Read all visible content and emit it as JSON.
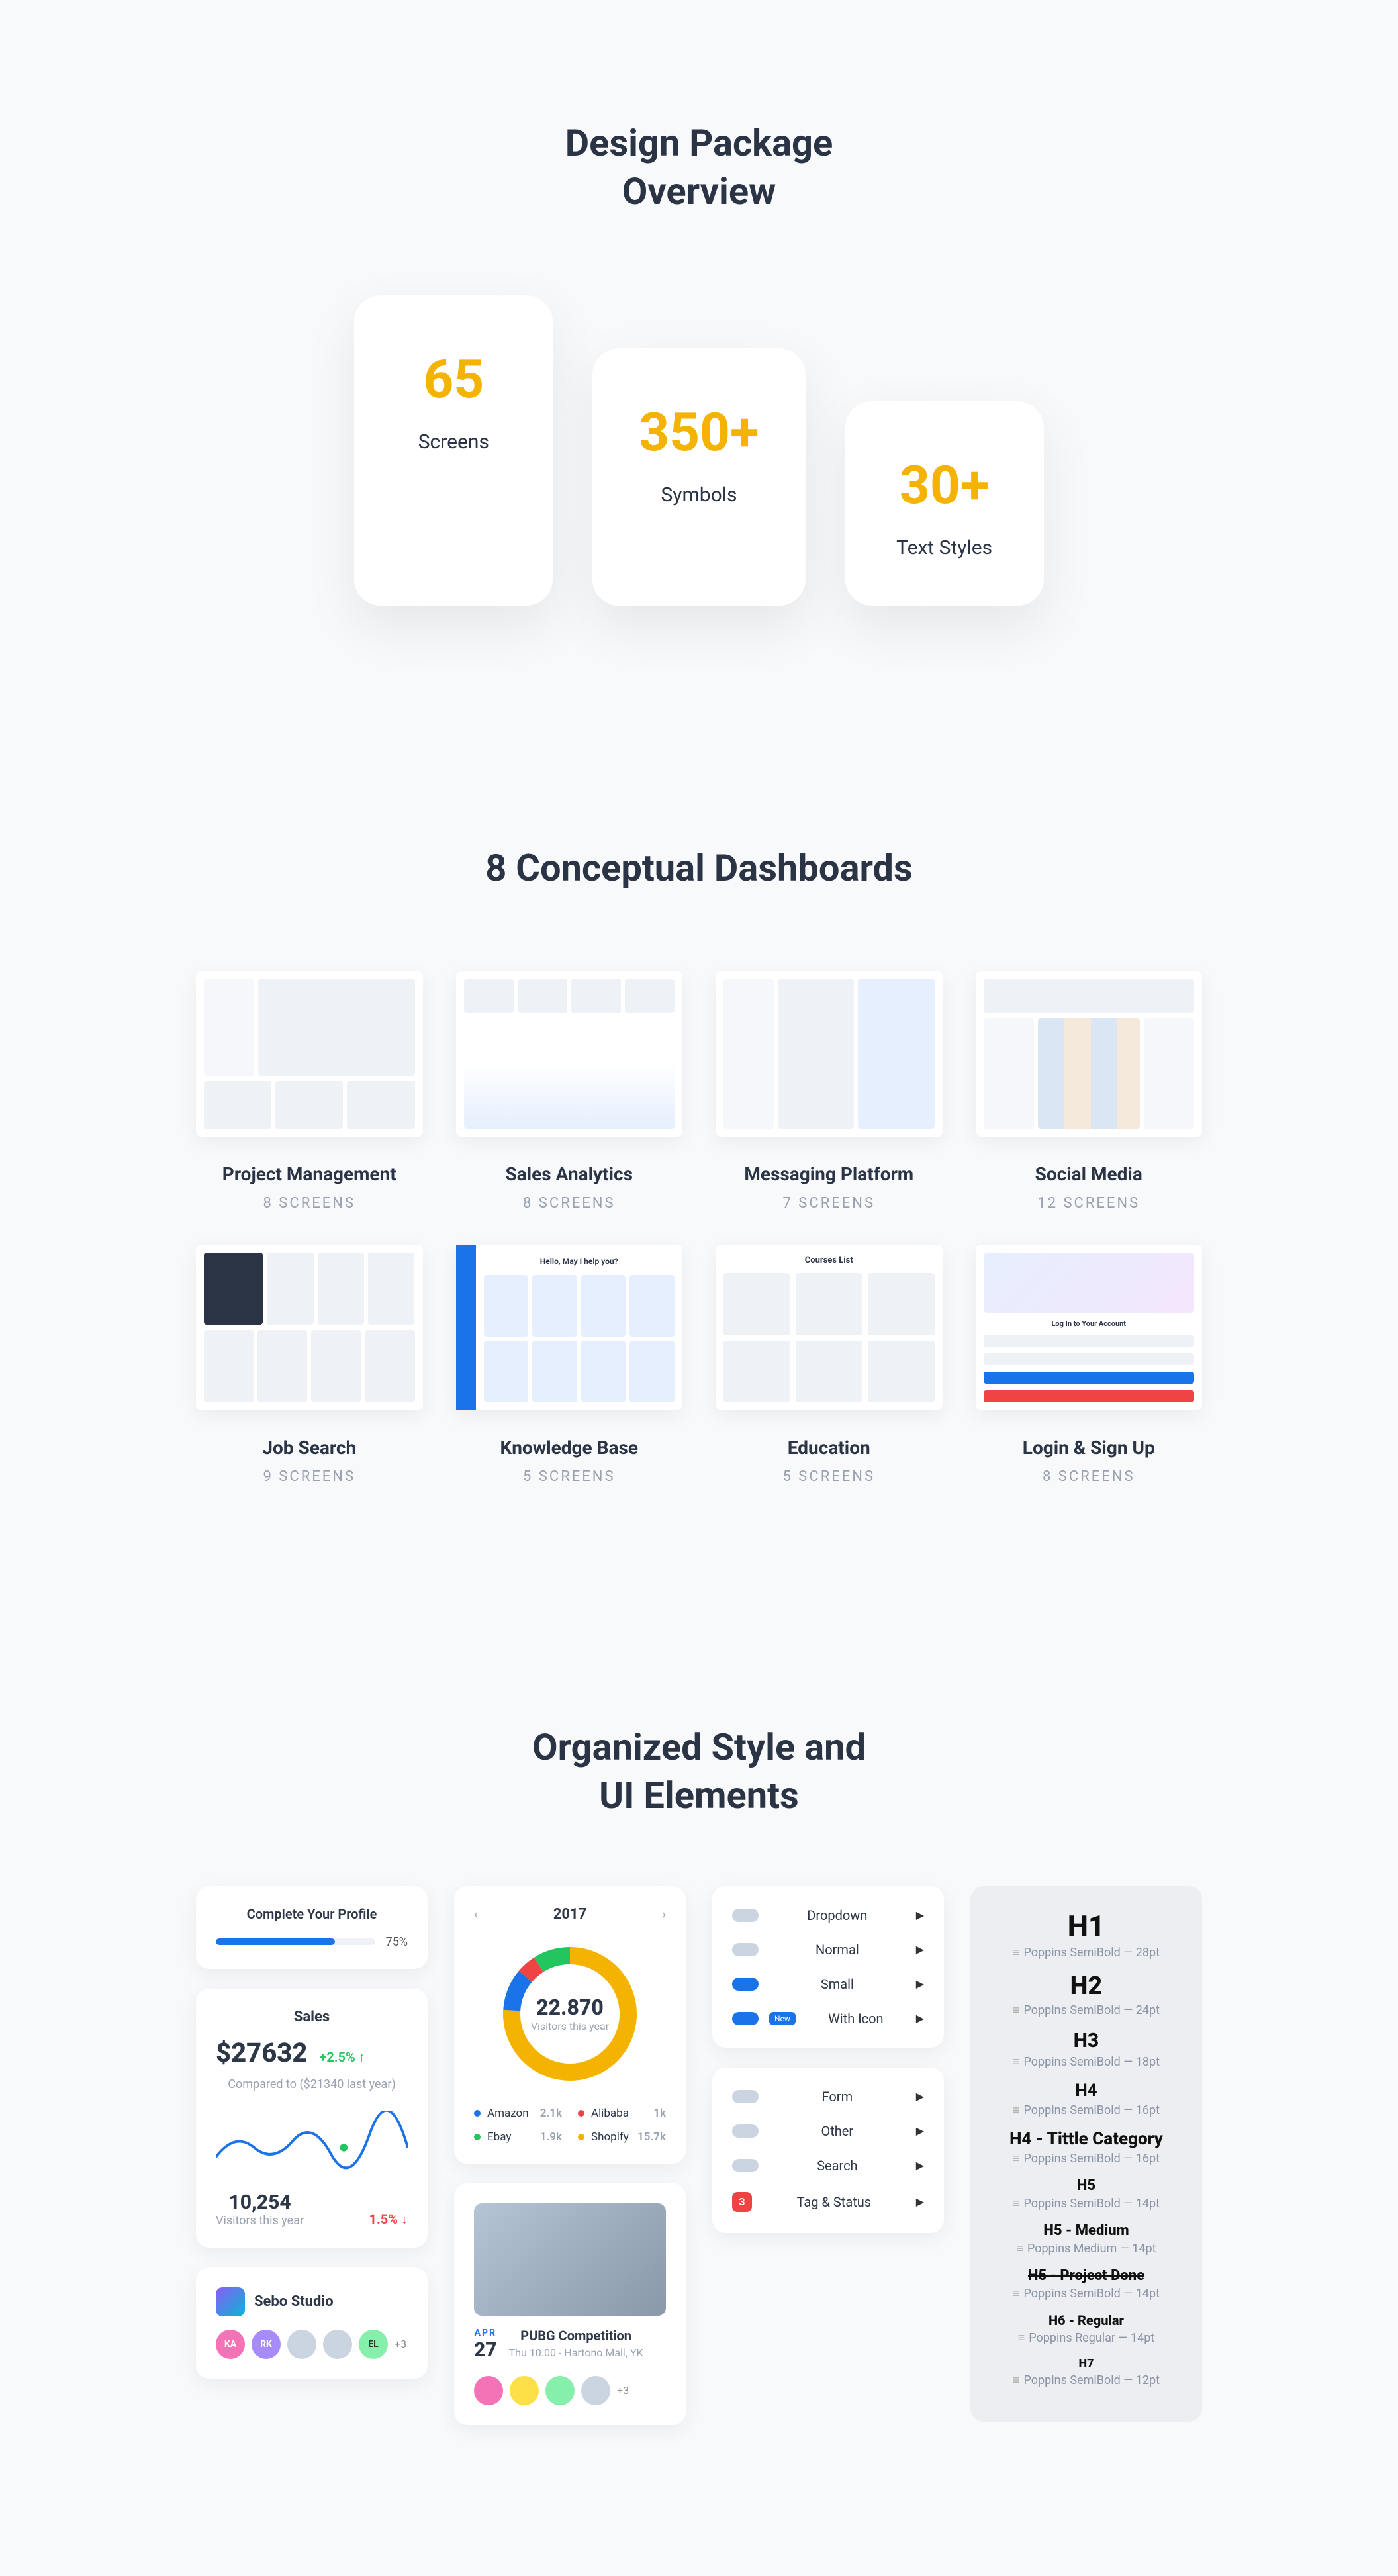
{
  "overview": {
    "title_line1": "Design Package",
    "title_line2": "Overview",
    "stats": [
      {
        "value": "65",
        "label": "Screens"
      },
      {
        "value": "350+",
        "label": "Symbols"
      },
      {
        "value": "30+",
        "label": "Text Styles"
      }
    ]
  },
  "dashboards": {
    "title": "8 Conceptual Dashboards",
    "items": [
      {
        "title": "Project Management",
        "sub": "8 Screens"
      },
      {
        "title": "Sales Analytics",
        "sub": "8 Screens"
      },
      {
        "title": "Messaging Platform",
        "sub": "7 Screens"
      },
      {
        "title": "Social Media",
        "sub": "12 Screens"
      },
      {
        "title": "Job Search",
        "sub": "9 Screens"
      },
      {
        "title": "Knowledge Base",
        "sub": "5 Screens"
      },
      {
        "title": "Education",
        "sub": "5 Screens"
      },
      {
        "title": "Login & Sign Up",
        "sub": "8 Screens"
      }
    ]
  },
  "ui": {
    "title_line1": "Organized Style and",
    "title_line2": "UI Elements",
    "profile": {
      "label": "Complete Your Profile",
      "pct": "75%"
    },
    "sales": {
      "title": "Sales",
      "value": "$27632",
      "change": "+2.5% ↑",
      "note": "Compared to ($21340 last year)"
    },
    "graph": {
      "value": "10,254",
      "sub": "Visitors this year",
      "change": "1.5% ↓"
    },
    "team": {
      "name": "Sebo Studio",
      "more": "+3"
    },
    "donut": {
      "year": "2017",
      "value": "22.870",
      "label": "Visitors this year",
      "legend": [
        {
          "name": "Amazon",
          "val": "2.1k",
          "color": "#1a73e8"
        },
        {
          "name": "Alibaba",
          "val": "1k",
          "color": "#ef4444"
        },
        {
          "name": "Ebay",
          "val": "1.9k",
          "color": "#22c55e"
        },
        {
          "name": "Shopify",
          "val": "15.7k",
          "color": "#f5b301"
        }
      ]
    },
    "event": {
      "month": "APR",
      "day": "27",
      "title": "PUBG Competition",
      "sub": "Thu 10.00 - Hartono Mall, YK",
      "more": "+3"
    },
    "menu1": [
      {
        "label": "Dropdown",
        "ico": ""
      },
      {
        "label": "Normal",
        "ico": ""
      },
      {
        "label": "Small",
        "ico": "blue"
      },
      {
        "label": "With Icon",
        "ico": "blue",
        "badge": "New"
      }
    ],
    "menu2": [
      {
        "label": "Form",
        "ico": ""
      },
      {
        "label": "Other",
        "ico": ""
      },
      {
        "label": "Search",
        "ico": ""
      },
      {
        "label": "Tag & Status",
        "ico": "tag",
        "count": "3"
      }
    ],
    "typo": [
      {
        "h": "H1",
        "s": "Poppins SemiBold — 28pt",
        "cls": "h1"
      },
      {
        "h": "H2",
        "s": "Poppins SemiBold — 24pt",
        "cls": "h2x"
      },
      {
        "h": "H3",
        "s": "Poppins SemiBold — 18pt",
        "cls": "h3"
      },
      {
        "h": "H4",
        "s": "Poppins SemiBold — 16pt",
        "cls": "h4"
      },
      {
        "h": "H4 - Tittle Category",
        "s": "Poppins SemiBold — 16pt",
        "cls": "h4"
      },
      {
        "h": "H5",
        "s": "Poppins SemiBold — 14pt",
        "cls": "h5"
      },
      {
        "h": "H5 - Medium",
        "s": "Poppins Medium — 14pt",
        "cls": "h5"
      },
      {
        "h": "H5 - Project Done",
        "s": "Poppins SemiBold — 14pt",
        "cls": "h5 strike"
      },
      {
        "h": "H6 - Regular",
        "s": "Poppins Regular — 14pt",
        "cls": "h6"
      },
      {
        "h": "H7",
        "s": "Poppins SemiBold — 12pt",
        "cls": "h7"
      }
    ]
  },
  "chart_data": {
    "type": "pie",
    "title": "Visitors this year — 2017",
    "categories": [
      "Amazon",
      "Alibaba",
      "Ebay",
      "Shopify"
    ],
    "values": [
      2100,
      1000,
      1900,
      15700
    ],
    "total_label": "22.870"
  }
}
